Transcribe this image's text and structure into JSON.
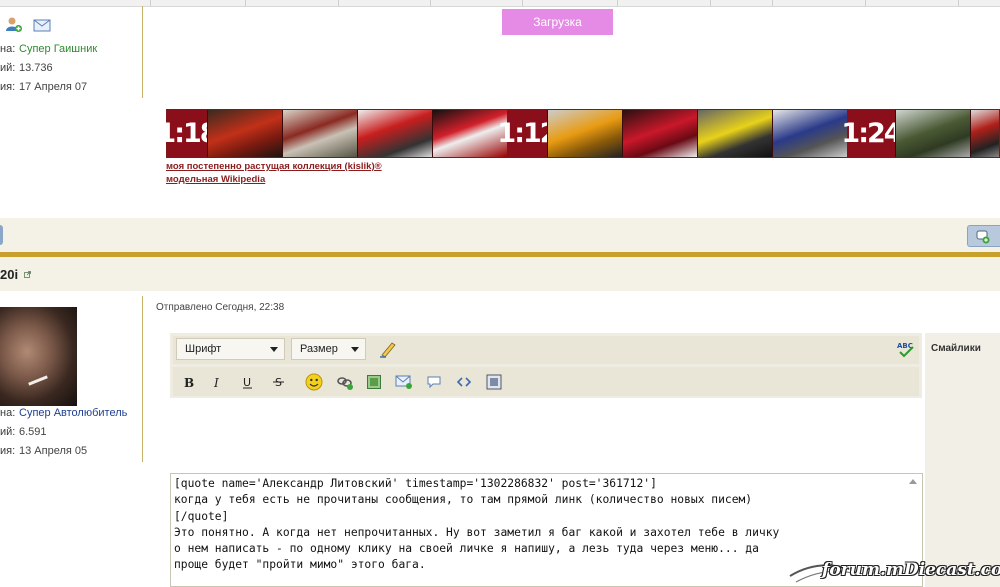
{
  "profile_top": {
    "rank_label": "на:",
    "rank_value": "Супер Гаишник",
    "posts_label": "ий:",
    "posts_value": "13.736",
    "reg_label": "ия:",
    "reg_value": "17 Апреля 07"
  },
  "signature": {
    "load_button": "Загрузка",
    "scales": [
      "1:18",
      "1:12",
      "1:24"
    ],
    "link1": "моя постепенно растущая коллекция (kislik)®",
    "link2": "модельная Wikipedia"
  },
  "post": {
    "author_name": "20i",
    "sent": "Отправлено Сегодня, 22:38",
    "rank_label": "на:",
    "rank_value": "Супер Автолюбитель",
    "posts_label": "ий:",
    "posts_value": "6.591",
    "reg_label": "ия:",
    "reg_value": "13 Апреля 05"
  },
  "editor": {
    "font_select": "Шрифт",
    "size_select": "Размер",
    "smilies_label": "Смайлики",
    "text_lines": [
      "[quote name='Александр Литовский' timestamp='1302286832' post='361712']",
      "когда у тебя есть не прочитаны сообщения, то там прямой линк (количество новых писем)",
      "[/quote]",
      "Это понятно. А когда нет непрочитанных. Ну вот заметил я баг какой и захотел тебе в личку",
      "о нем написать - по одному клику на своей личке я напишу, а лезь туда через меню... да",
      "проще будет \"пройти мимо\" этого бага."
    ]
  },
  "watermark": "forum.mDiecast.com",
  "colors": {
    "accent_gold": "#c6a02a",
    "load_button_bg": "#e58be6",
    "scale_bg": "#8b0f1a",
    "link_red": "#8b1c1c"
  }
}
